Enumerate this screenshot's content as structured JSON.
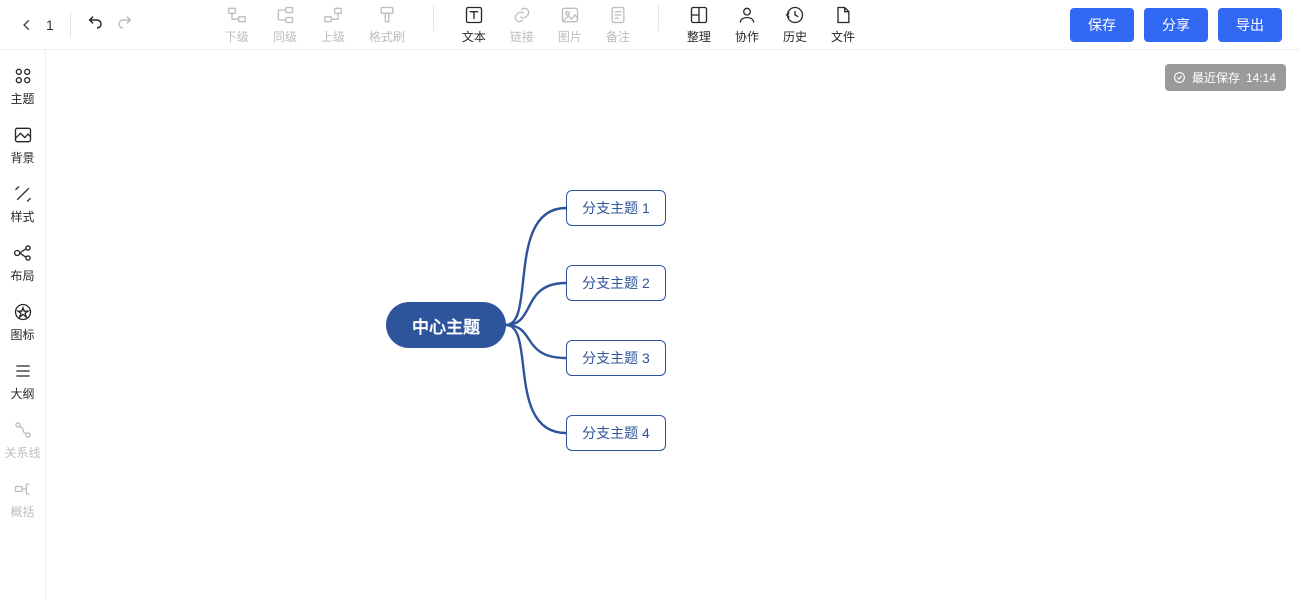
{
  "header": {
    "page_number": "1",
    "tools": {
      "child": "下级",
      "sibling": "同级",
      "parent": "上级",
      "format_brush": "格式刷",
      "text": "文本",
      "link": "链接",
      "image": "图片",
      "note": "备注",
      "arrange": "整理",
      "collab": "协作",
      "history": "历史",
      "file": "文件"
    },
    "buttons": {
      "save": "保存",
      "share": "分享",
      "export": "导出"
    }
  },
  "sidebar": {
    "theme": "主题",
    "background": "背景",
    "style": "样式",
    "layout": "布局",
    "icons": "图标",
    "outline": "大纲",
    "relation": "关系线",
    "summary": "概括"
  },
  "save_badge": {
    "prefix": "最近保存",
    "time": "14:14"
  },
  "mindmap": {
    "center": "中心主题",
    "branches": [
      "分支主题 1",
      "分支主题 2",
      "分支主题 3",
      "分支主题 4"
    ]
  }
}
